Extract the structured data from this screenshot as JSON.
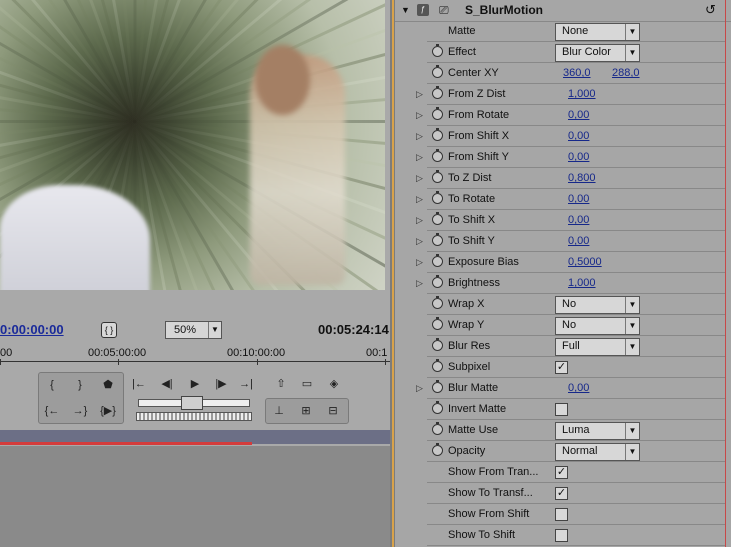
{
  "monitor": {
    "current_time": "0:00:00:00",
    "duration": "00:05:24:14",
    "zoom": "50%",
    "ruler_labels": [
      "00",
      "00:05:00:00",
      "00:10:00:00",
      "00:1"
    ],
    "icons": {
      "marker": "marker-brackets-icon",
      "transport": [
        "set-in-icon",
        "set-out-icon",
        "set-marker-icon",
        "step-back-icon",
        "play-icon",
        "step-forward-icon",
        "go-to-end-icon",
        "lift-icon",
        "overlay-icon",
        "safe-margins-icon",
        "go-to-in-icon",
        "go-to-out-icon",
        "play-in-to-out-icon",
        "trim-icon",
        "insert-icon",
        "export-frame-icon"
      ]
    }
  },
  "effect": {
    "name": "S_BlurMotion",
    "params": [
      {
        "label": "Matte",
        "type": "dropdown",
        "value": "None",
        "stopwatch": false,
        "twirl": false
      },
      {
        "label": "Effect",
        "type": "dropdown",
        "value": "Blur Color",
        "stopwatch": true,
        "twirl": false
      },
      {
        "label": "Center XY",
        "type": "xy",
        "x": "360,0",
        "y": "288,0",
        "stopwatch": true,
        "twirl": false
      },
      {
        "label": "From Z Dist",
        "type": "number",
        "value": "1,000",
        "stopwatch": true,
        "twirl": true
      },
      {
        "label": "From Rotate",
        "type": "number",
        "value": "0,00",
        "stopwatch": true,
        "twirl": true
      },
      {
        "label": "From Shift X",
        "type": "number",
        "value": "0,00",
        "stopwatch": true,
        "twirl": true
      },
      {
        "label": "From Shift Y",
        "type": "number",
        "value": "0,00",
        "stopwatch": true,
        "twirl": true
      },
      {
        "label": "To Z Dist",
        "type": "number",
        "value": "0,800",
        "stopwatch": true,
        "twirl": true
      },
      {
        "label": "To Rotate",
        "type": "number",
        "value": "0,00",
        "stopwatch": true,
        "twirl": true
      },
      {
        "label": "To Shift X",
        "type": "number",
        "value": "0,00",
        "stopwatch": true,
        "twirl": true
      },
      {
        "label": "To Shift Y",
        "type": "number",
        "value": "0,00",
        "stopwatch": true,
        "twirl": true
      },
      {
        "label": "Exposure Bias",
        "type": "number",
        "value": "0,5000",
        "stopwatch": true,
        "twirl": true
      },
      {
        "label": "Brightness",
        "type": "number",
        "value": "1,000",
        "stopwatch": true,
        "twirl": true
      },
      {
        "label": "Wrap X",
        "type": "dropdown",
        "value": "No",
        "stopwatch": true,
        "twirl": false
      },
      {
        "label": "Wrap Y",
        "type": "dropdown",
        "value": "No",
        "stopwatch": true,
        "twirl": false
      },
      {
        "label": "Blur Res",
        "type": "dropdown",
        "value": "Full",
        "stopwatch": true,
        "twirl": false
      },
      {
        "label": "Subpixel",
        "type": "checkbox",
        "checked": true,
        "stopwatch": true,
        "twirl": false
      },
      {
        "label": "Blur Matte",
        "type": "number",
        "value": "0,00",
        "stopwatch": true,
        "twirl": true
      },
      {
        "label": "Invert Matte",
        "type": "checkbox",
        "checked": false,
        "stopwatch": true,
        "twirl": false
      },
      {
        "label": "Matte Use",
        "type": "dropdown",
        "value": "Luma",
        "stopwatch": true,
        "twirl": false
      },
      {
        "label": "Opacity",
        "type": "dropdown",
        "value": "Normal",
        "stopwatch": true,
        "twirl": false
      },
      {
        "label": "Show From Tran...",
        "type": "checkbox",
        "checked": true,
        "stopwatch": false,
        "twirl": false
      },
      {
        "label": "Show To Transf...",
        "type": "checkbox",
        "checked": true,
        "stopwatch": false,
        "twirl": false
      },
      {
        "label": "Show From Shift",
        "type": "checkbox",
        "checked": false,
        "stopwatch": false,
        "twirl": false
      },
      {
        "label": "Show To Shift",
        "type": "checkbox",
        "checked": false,
        "stopwatch": false,
        "twirl": false
      }
    ]
  },
  "colors": {
    "timecode_link": "#1a2a9a",
    "value_link": "#16288a",
    "divider_accent": "#d8a24a",
    "playhead_red": "#d43c3c"
  }
}
